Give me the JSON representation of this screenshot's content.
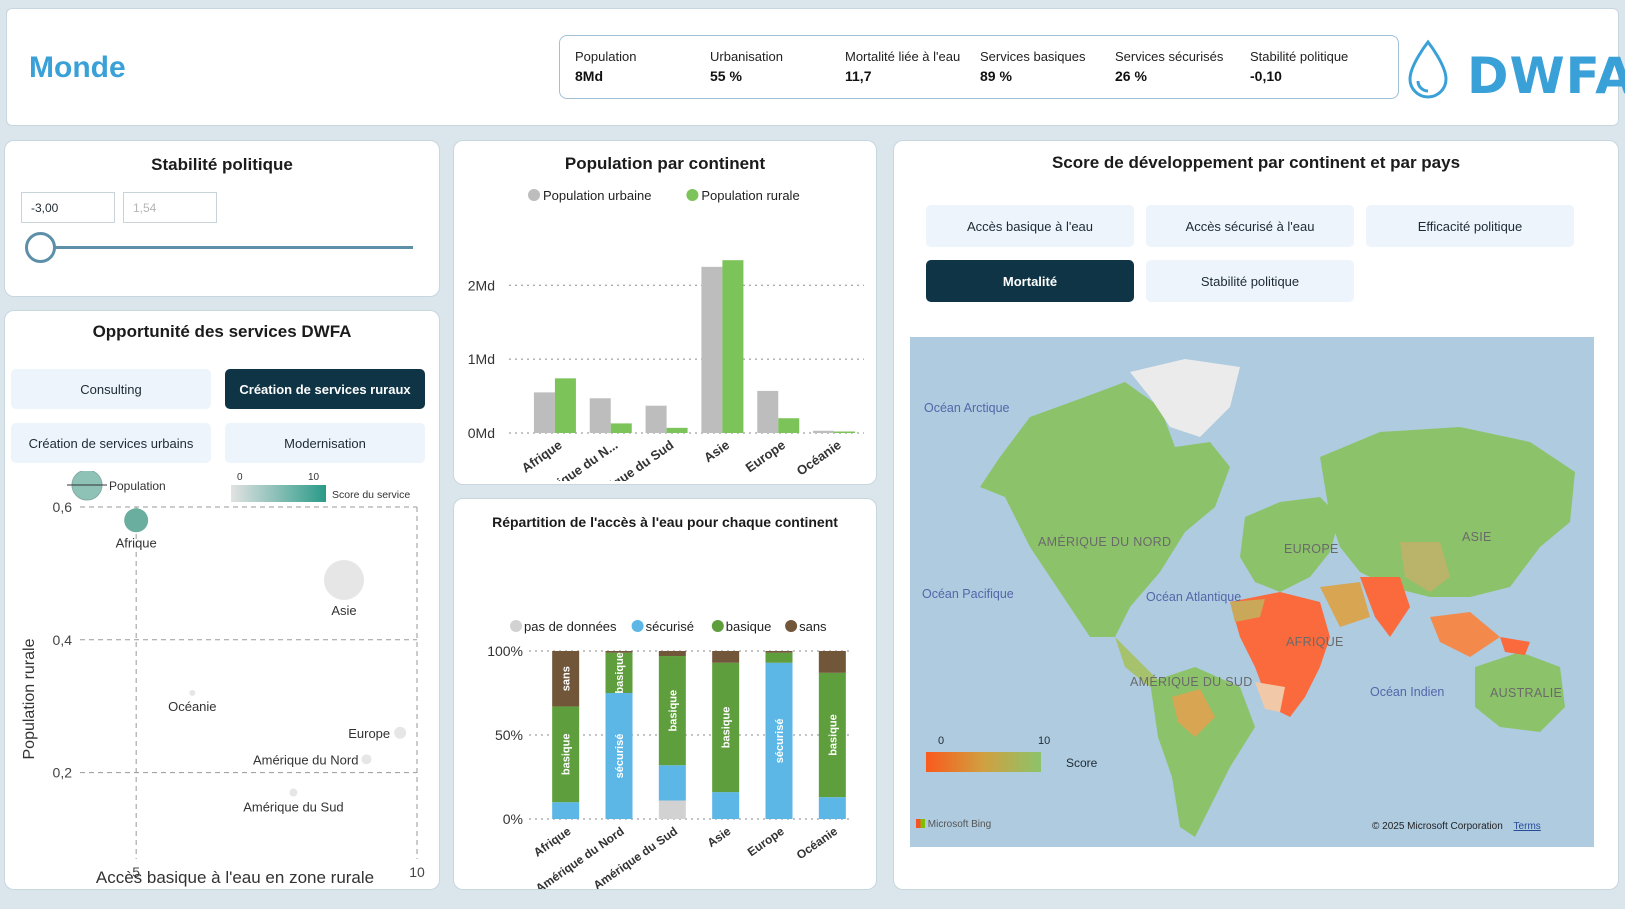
{
  "header": {
    "title": "Monde",
    "logo_text": "DWFA",
    "kpis": [
      {
        "label": "Population",
        "value": "8Md"
      },
      {
        "label": "Urbanisation",
        "value": "55 %"
      },
      {
        "label": "Mortalité liée à l'eau",
        "value": "11,7"
      },
      {
        "label": "Services basiques",
        "value": "89 %"
      },
      {
        "label": "Services sécurisés",
        "value": "26 %"
      },
      {
        "label": "Stabilité politique",
        "value": "-0,10"
      }
    ]
  },
  "slicer": {
    "title": "Stabilité politique",
    "min_value": "-3,00",
    "max_value": "1,54"
  },
  "opportunity": {
    "title": "Opportunité des services DWFA",
    "buttons": [
      {
        "label": "Consulting",
        "active": false
      },
      {
        "label": "Création de services ruraux",
        "active": true
      },
      {
        "label": "Création de services urbains",
        "active": false
      },
      {
        "label": "Modernisation",
        "active": false
      }
    ],
    "legend_size_label": "Population",
    "legend_color_label": "Score du service",
    "legend_color_min": "0",
    "legend_color_max": "10",
    "chart_data": {
      "type": "scatter",
      "xlabel": "Accès basique à l'eau en zone rurale",
      "ylabel": "Population rurale",
      "xlim": [
        5,
        10
      ],
      "ylim": [
        0.1,
        0.6
      ],
      "x_ticks": [
        "5",
        "10"
      ],
      "y_ticks": [
        "0,2",
        "0,4",
        "0,6"
      ],
      "points": [
        {
          "label": "Afrique",
          "x": 5.0,
          "y": 0.58,
          "color": "#6aaea0"
        },
        {
          "label": "Asie",
          "x": 8.7,
          "y": 0.49,
          "color": "#e6e6e6"
        },
        {
          "label": "Océanie",
          "x": 6.0,
          "y": 0.32,
          "color": "#e6e6e6"
        },
        {
          "label": "Europe",
          "x": 9.7,
          "y": 0.26,
          "color": "#e6e6e6"
        },
        {
          "label": "Amérique du Nord",
          "x": 9.1,
          "y": 0.22,
          "color": "#e6e6e6"
        },
        {
          "label": "Amérique du Sud",
          "x": 7.8,
          "y": 0.17,
          "color": "#e6e6e6"
        }
      ]
    }
  },
  "population_chart": {
    "title": "Population par continent",
    "chart_data": {
      "type": "bar",
      "categories": [
        "Afrique",
        "Amérique du N...",
        "Amérique du Sud",
        "Asie",
        "Europe",
        "Océanie"
      ],
      "series": [
        {
          "name": "Population urbaine",
          "color": "#bdbdbd",
          "values": [
            0.55,
            0.47,
            0.37,
            2.25,
            0.57,
            0.03
          ]
        },
        {
          "name": "Population rurale",
          "color": "#7cc35a",
          "values": [
            0.74,
            0.13,
            0.07,
            2.34,
            0.2,
            0.02
          ]
        }
      ],
      "ylim": [
        0,
        2.6
      ],
      "y_ticks": [
        "0Md",
        "1Md",
        "2Md"
      ]
    }
  },
  "water_chart": {
    "title": "Répartition de l'accès à l'eau pour chaque continent",
    "chart_data": {
      "type": "bar",
      "stacked": true,
      "categories": [
        "Afrique",
        "Amérique du Nord",
        "Amérique du Sud",
        "Asie",
        "Europe",
        "Océanie"
      ],
      "series": [
        {
          "name": "pas de données",
          "color": "#d2d2d2",
          "values": [
            0,
            0,
            11,
            0,
            0,
            0
          ]
        },
        {
          "name": "sécurisé",
          "color": "#5db7e6",
          "values": [
            10,
            75,
            21,
            16,
            93,
            13
          ]
        },
        {
          "name": "basique",
          "color": "#5e9e3c",
          "values": [
            57,
            24,
            65,
            77,
            6,
            74
          ]
        },
        {
          "name": "sans",
          "color": "#72563a",
          "values": [
            33,
            1,
            3,
            7,
            1,
            13
          ]
        }
      ],
      "y_ticks": [
        "0%",
        "50%",
        "100%"
      ],
      "segment_labels": {
        "sans": "sans",
        "sécurisé": "sécurisé",
        "basique": "basique"
      }
    }
  },
  "map_card": {
    "title": "Score de développement par continent et par pays",
    "buttons": [
      {
        "label": "Accès basique à l'eau",
        "active": false
      },
      {
        "label": "Accès sécurisé à l'eau",
        "active": false
      },
      {
        "label": "Efficacité politique",
        "active": false
      },
      {
        "label": "Mortalité",
        "active": true
      },
      {
        "label": "Stabilité politique",
        "active": false
      }
    ],
    "oceans": [
      "Océan Arctique",
      "Océan Pacifique",
      "Océan Atlantique",
      "Océan Indien"
    ],
    "continents": [
      "AMÉRIQUE DU NORD",
      "EUROPE",
      "ASIE",
      "AFRIQUE",
      "AMÉRIQUE DU SUD",
      "AUSTRALIE"
    ],
    "legend_min": "0",
    "legend_max": "10",
    "legend_label": "Score",
    "attribution_left": "Microsoft Bing",
    "attribution_right": "© 2025 Microsoft Corporation",
    "terms": "Terms",
    "colors": {
      "good": "#8cc36a",
      "bad": "#fa6a3c",
      "water": "#aecbe0"
    }
  }
}
